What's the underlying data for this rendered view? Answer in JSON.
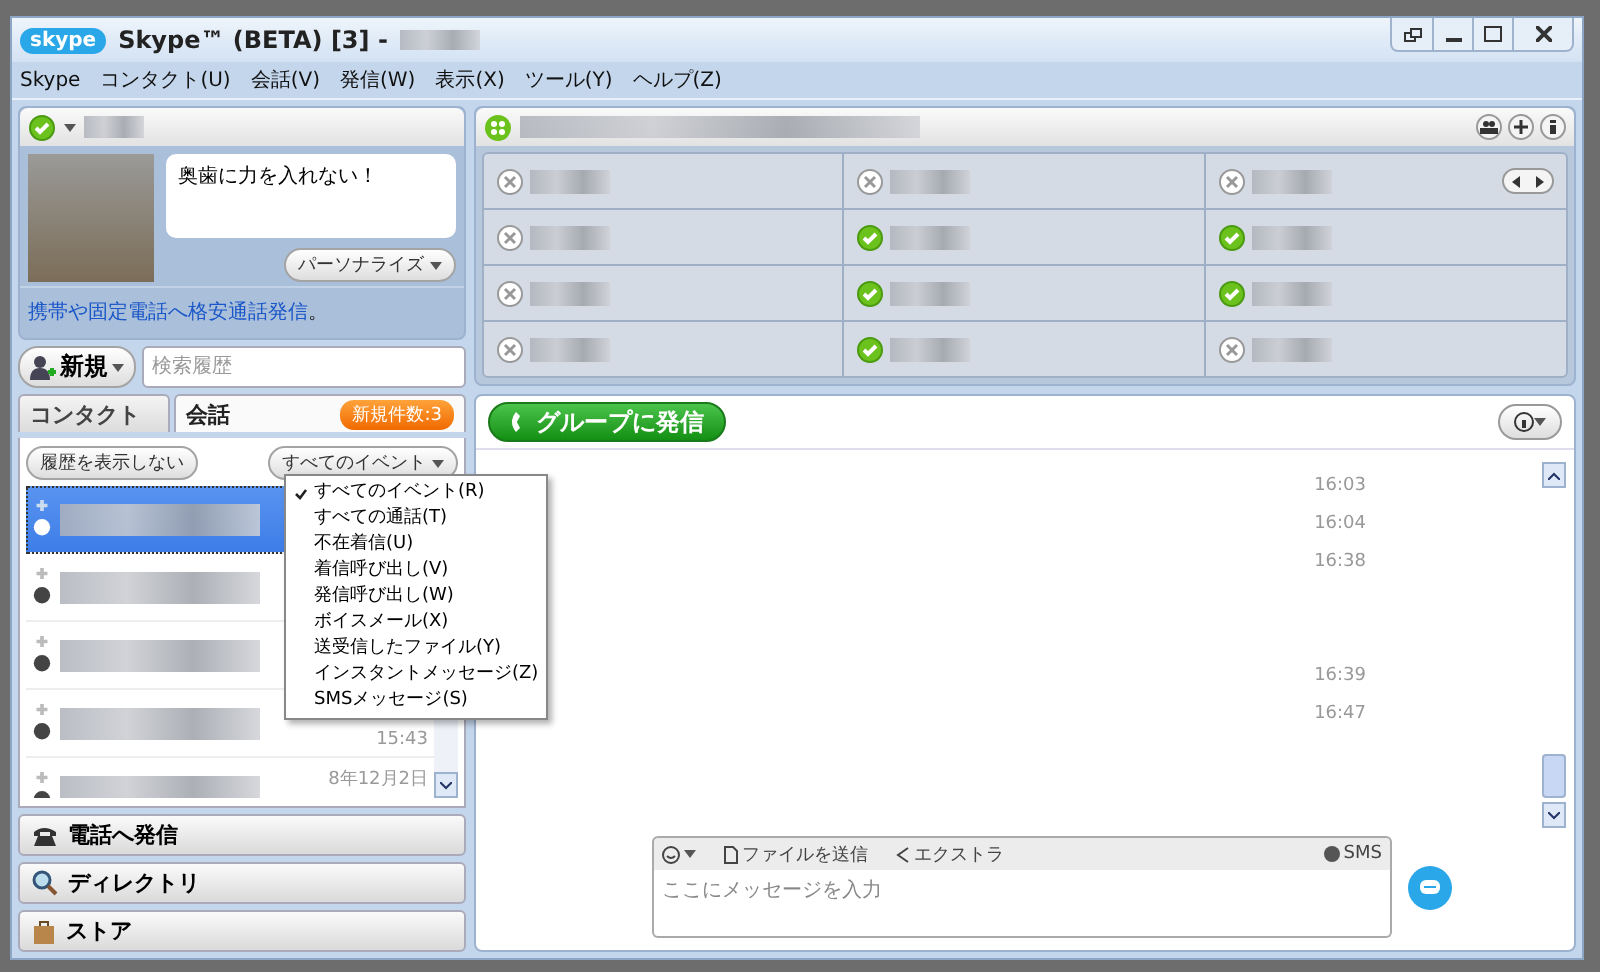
{
  "window": {
    "logo": "skype",
    "title": "Skype™ (BETA) [3] -"
  },
  "menu_bar": [
    "Skype",
    "コンタクト(U)",
    "会話(V)",
    "発信(W)",
    "表示(X)",
    "ツール(Y)",
    "ヘルプ(Z)"
  ],
  "profile": {
    "mood_message": "奥歯に力を入れない！",
    "personalize_button": "パーソナライズ",
    "promo_link": "携帯や固定電話へ格安通話発信",
    "promo_suffix": "。"
  },
  "new_button": "新規",
  "search": {
    "placeholder": "検索履歴"
  },
  "tabs": [
    {
      "label": "コンタクト",
      "selected": false
    },
    {
      "label": "会話",
      "selected": true
    }
  ],
  "new_badge": "新規件数:3",
  "history_toggle": "履歴を表示しない",
  "event_filter": "すべてのイベント",
  "history_rows": [
    {
      "selected": true
    },
    {
      "selected": false
    },
    {
      "selected": false
    },
    {
      "selected": false,
      "time": "15:43"
    },
    {
      "selected": false,
      "date": "8年12月2日"
    }
  ],
  "filter_menu": [
    {
      "label": "すべてのイベント(R)",
      "checked": true
    },
    {
      "label": "すべての通話(T)",
      "checked": false
    },
    {
      "label": "不在着信(U)",
      "checked": false
    },
    {
      "label": "着信呼び出し(V)",
      "checked": false
    },
    {
      "label": "発信呼び出し(W)",
      "checked": false
    },
    {
      "label": "ボイスメール(X)",
      "checked": false
    },
    {
      "label": "送受信したファイル(Y)",
      "checked": false
    },
    {
      "label": "インスタントメッセージ(Z)",
      "checked": false
    },
    {
      "label": "SMSメッセージ(S)",
      "checked": false
    }
  ],
  "side_buttons": [
    {
      "label": "電話へ発信",
      "kind": "phone"
    },
    {
      "label": "ディレクトリ",
      "kind": "directory"
    },
    {
      "label": "ストア",
      "kind": "store"
    }
  ],
  "participants": [
    {
      "online": false
    },
    {
      "online": false
    },
    {
      "online": false
    },
    {
      "online": false
    },
    {
      "online": true
    },
    {
      "online": true
    },
    {
      "online": false
    },
    {
      "online": true
    },
    {
      "online": true
    },
    {
      "online": false
    },
    {
      "online": true
    },
    {
      "online": false
    }
  ],
  "chat": {
    "call_button": "グループに発信",
    "messages": [
      {
        "kind": "time",
        "time": "16:03"
      },
      {
        "kind": "time",
        "time": "16:04"
      },
      {
        "kind": "time",
        "time": "16:38"
      },
      {
        "kind": "gap"
      },
      {
        "kind": "gap"
      },
      {
        "kind": "time",
        "time": "16:39"
      },
      {
        "kind": "time",
        "time": "16:47"
      }
    ]
  },
  "compose": {
    "send_file": "ファイルを送信",
    "extras": "エクストラ",
    "sms": "SMS",
    "placeholder": "ここにメッセージを入力"
  }
}
